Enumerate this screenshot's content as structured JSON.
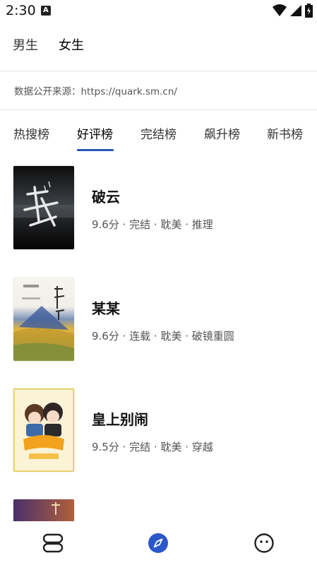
{
  "status_bar": {
    "time": "2:30",
    "notification_icon": "a-notification-icon",
    "icons": [
      "wifi-icon",
      "cellular-signal-icon",
      "battery-icon"
    ]
  },
  "gender_tabs": [
    {
      "label": "男生",
      "selected": false
    },
    {
      "label": "女生",
      "selected": true
    }
  ],
  "source_text": "数据公开来源：https://quark.sm.cn/",
  "rank_tabs": [
    {
      "label": "热搜榜",
      "selected": false
    },
    {
      "label": "好评榜",
      "selected": true
    },
    {
      "label": "完结榜",
      "selected": false
    },
    {
      "label": "飙升榜",
      "selected": false
    },
    {
      "label": "新书榜",
      "selected": false
    }
  ],
  "accent_color": "#2b56b8",
  "books": [
    {
      "title": "破云",
      "meta": "9.6分 · 完结 · 耽美 · 推理"
    },
    {
      "title": "某某",
      "meta": "9.6分 · 连载 · 耽美 · 破镜重圆"
    },
    {
      "title": "皇上别闹",
      "meta": "9.5分 · 完结 · 耽美 · 穿越"
    },
    {
      "title": "",
      "meta": ""
    }
  ],
  "bottom_nav": [
    {
      "icon": "bookshelf-icon",
      "active": false
    },
    {
      "icon": "compass-icon",
      "active": true
    },
    {
      "icon": "profile-face-icon",
      "active": false
    }
  ]
}
